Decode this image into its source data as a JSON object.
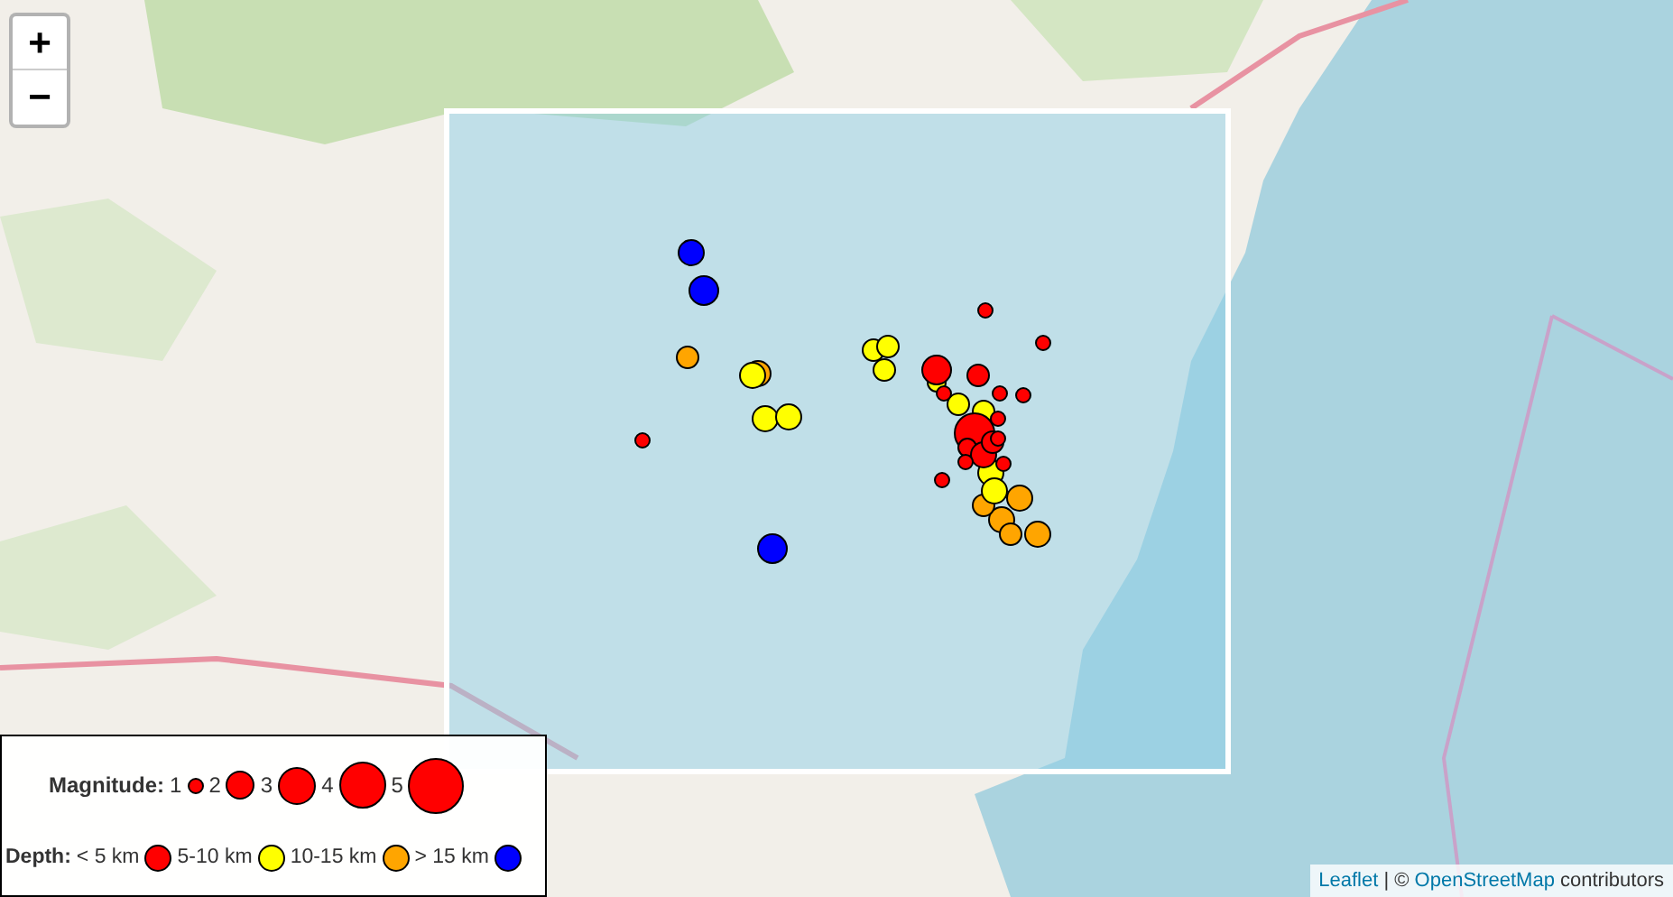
{
  "zoom_controls": [
    {
      "label": "+"
    },
    {
      "label": "−"
    }
  ],
  "markers": [
    {
      "color": "#0000ff"
    },
    {
      "color": "#0000ff"
    },
    {
      "color": "#0000ff"
    },
    {
      "color": "#ffa500"
    },
    {
      "color": "#ffa500"
    },
    {
      "color": "#ffa500"
    },
    {
      "color": "#ffa500"
    },
    {
      "color": "#ffa500"
    },
    {
      "color": "#ffa500"
    },
    {
      "color": "#ffa500"
    },
    {
      "color": "#ffff00"
    },
    {
      "color": "#ffff00"
    },
    {
      "color": "#ffff00"
    },
    {
      "color": "#ffff00"
    },
    {
      "color": "#ffff00"
    },
    {
      "color": "#ffff00"
    },
    {
      "color": "#ffff00"
    },
    {
      "color": "#ffff00"
    },
    {
      "color": "#ffff00"
    },
    {
      "color": "#ffff00"
    },
    {
      "color": "#ffff00"
    },
    {
      "color": "#ff0000"
    },
    {
      "color": "#ff0000"
    },
    {
      "color": "#ff0000"
    },
    {
      "color": "#ff0000"
    },
    {
      "color": "#ff0000"
    },
    {
      "color": "#ff0000"
    },
    {
      "color": "#ff0000"
    },
    {
      "color": "#ff0000"
    },
    {
      "color": "#ff0000"
    },
    {
      "color": "#ff0000"
    },
    {
      "color": "#ff0000"
    },
    {
      "color": "#ff0000"
    },
    {
      "color": "#ff0000"
    },
    {
      "color": "#ff0000"
    },
    {
      "color": "#ff0000"
    },
    {
      "color": "#ff0000"
    },
    {
      "color": "#ff0000"
    }
  ],
  "legend": {
    "magnitude": {
      "label": "Magnitude:",
      "items": [
        "1",
        "2",
        "3",
        "4",
        "5"
      ]
    },
    "depth": {
      "label": "Depth:",
      "items": [
        {
          "label": "< 5 km",
          "color": "#ff0000"
        },
        {
          "label": "5-10 km",
          "color": "#ffff00"
        },
        {
          "label": "10-15 km",
          "color": "#ffa500"
        },
        {
          "label": "> 15 km",
          "color": "#0000ff"
        }
      ]
    }
  },
  "attribution": {
    "links": [
      "Leaflet",
      "OpenStreetMap"
    ],
    "separator": "| ©",
    "suffix": "contributors"
  }
}
